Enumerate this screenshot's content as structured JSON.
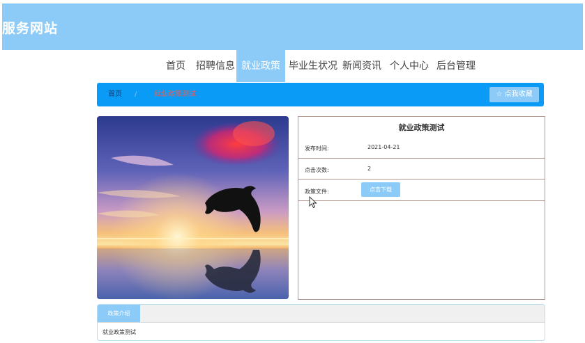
{
  "header": {
    "title": "服务网站"
  },
  "nav": {
    "items": [
      "首页",
      "招聘信息",
      "就业政策",
      "毕业生状况",
      "新闻资讯",
      "个人中心",
      "后台管理"
    ]
  },
  "breadcrumb": {
    "home": "首页",
    "separator": "/",
    "current": "就业政策测试"
  },
  "favorite_button": "☆ 点我收藏",
  "detail": {
    "title": "就业政策测试",
    "publish_label": "发布时间:",
    "publish_value": "2021-04-21",
    "clicks_label": "点击次数:",
    "clicks_value": "2",
    "file_label": "政策文件:",
    "download_button": "点击下载"
  },
  "intro": {
    "tab": "政策介绍",
    "content": "就业政策测试"
  },
  "colors": {
    "header_bg": "#8ccbf8",
    "breadcrumb_bg": "#0a9bf6",
    "current_crumb": "#e2625b",
    "border": "#b49a8c"
  },
  "icons": {
    "favorite": "star-outline-icon",
    "cursor": "mouse-pointer-icon"
  }
}
